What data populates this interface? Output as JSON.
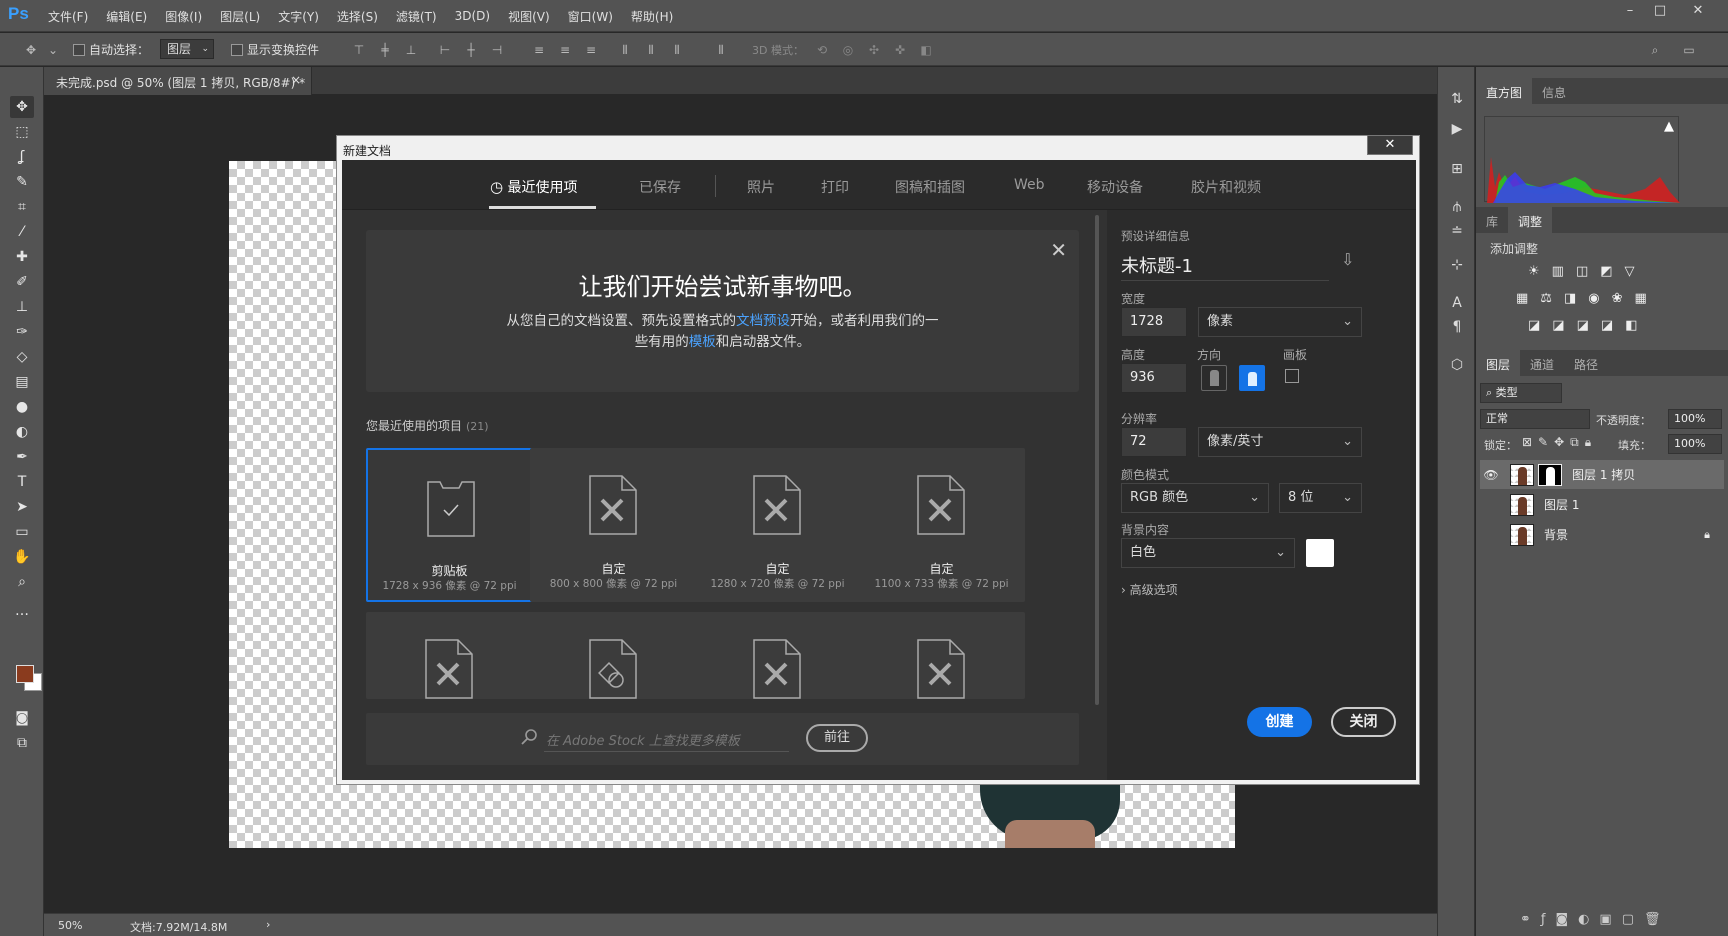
{
  "app": {
    "logo": "Ps"
  },
  "menu": [
    "文件(F)",
    "编辑(E)",
    "图像(I)",
    "图层(L)",
    "文字(Y)",
    "选择(S)",
    "滤镜(T)",
    "3D(D)",
    "视图(V)",
    "窗口(W)",
    "帮助(H)"
  ],
  "options_bar": {
    "auto_select_label": "自动选择：",
    "auto_select_value": "图层",
    "show_transform_label": "显示变换控件",
    "mode_3d_label": "3D 模式："
  },
  "document_tab": {
    "title": "未完成.psd @ 50% (图层 1 拷贝, RGB/8#) *",
    "close": "×"
  },
  "status_bar": {
    "zoom": "50%",
    "doc_info": "文档:7.92M/14.8M",
    "arrow": "›"
  },
  "panels": {
    "top_tabs": [
      "直方图",
      "信息"
    ],
    "adjust_tabs": [
      "库",
      "调整"
    ],
    "add_adjustment": "添加调整",
    "layers_tabs": [
      "图层",
      "通道",
      "路径"
    ],
    "filter_kind": "类型",
    "blend_mode": "正常",
    "opacity_label": "不透明度：",
    "opacity_value": "100%",
    "lock_label": "锁定：",
    "fill_label": "填充：",
    "fill_value": "100%",
    "layers": [
      {
        "name": "图层 1 拷贝",
        "visible": true,
        "selected": true
      },
      {
        "name": "图层 1",
        "visible": false,
        "selected": false
      },
      {
        "name": "背景",
        "visible": false,
        "selected": false,
        "locked": true
      }
    ]
  },
  "dialog": {
    "title": "新建文档",
    "close": "✕",
    "tabs": [
      "最近使用项",
      "已保存",
      "照片",
      "打印",
      "图稿和插图",
      "Web",
      "移动设备",
      "胶片和视频"
    ],
    "welcome_title": "让我们开始尝试新事物吧。",
    "welcome_line1_a": "从您自己的文档设置、预先设置格式的",
    "welcome_link1": "文档预设",
    "welcome_line1_b": "开始，或者利用我们的一",
    "welcome_line2_a": "些有用的",
    "welcome_link2": "模板",
    "welcome_line2_b": "和启动器文件。",
    "recent_label": "您最近使用的项目",
    "recent_count": "(21)",
    "presets": [
      {
        "name": "剪贴板",
        "size": "1728 x 936 像素 @ 72 ppi"
      },
      {
        "name": "自定",
        "size": "800 x 800 像素 @ 72 ppi"
      },
      {
        "name": "自定",
        "size": "1280 x 720 像素 @ 72 ppi"
      },
      {
        "name": "自定",
        "size": "1100 x 733 像素 @ 72 ppi"
      }
    ],
    "stock_placeholder": "在 Adobe Stock 上查找更多模板",
    "goto_button": "前往",
    "details": {
      "header": "预设详细信息",
      "doc_name": "未标题-1",
      "width_label": "宽度",
      "width": "1728",
      "width_unit": "像素",
      "height_label": "高度",
      "height": "936",
      "orientation_label": "方向",
      "artboard_label": "画板",
      "resolution_label": "分辨率",
      "resolution": "72",
      "resolution_unit": "像素/英寸",
      "color_mode_label": "颜色模式",
      "color_mode": "RGB 颜色",
      "bit_depth": "8 位",
      "background_label": "背景内容",
      "background": "白色",
      "advanced": "高级选项",
      "create": "创建",
      "close": "关闭"
    }
  },
  "colors": {
    "accent": "#1473e6",
    "foreground_swatch": "#8a3b1e",
    "background_swatch": "#ffffff"
  }
}
